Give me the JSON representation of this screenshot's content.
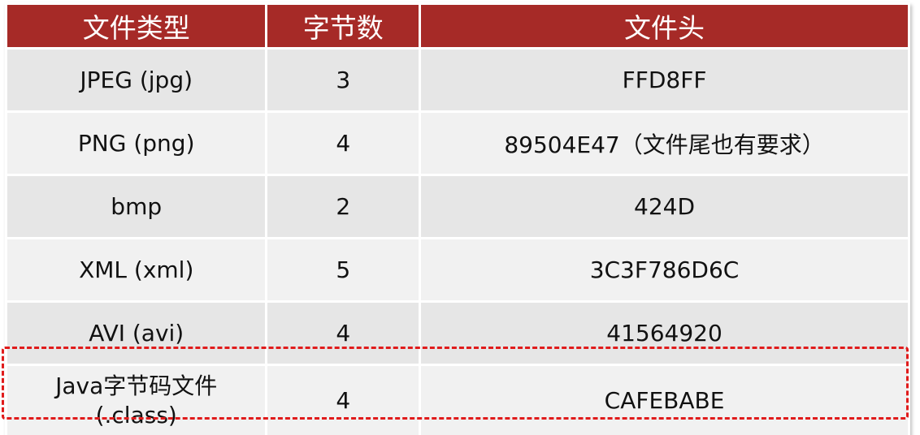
{
  "table": {
    "headers": [
      "文件类型",
      "字节数",
      "文件头"
    ],
    "rows": [
      {
        "type": "JPEG (jpg)",
        "bytes": "3",
        "header": "FFD8FF"
      },
      {
        "type": "PNG (png)",
        "bytes": "4",
        "header": "89504E47（文件尾也有要求）"
      },
      {
        "type": "bmp",
        "bytes": "2",
        "header": "424D"
      },
      {
        "type": "XML (xml)",
        "bytes": "5",
        "header": "3C3F786D6C"
      },
      {
        "type": "AVI (avi)",
        "bytes": "4",
        "header": "41564920"
      },
      {
        "type_line1": "Java字节码文件",
        "type_line2": "(.class)",
        "bytes": "4",
        "header": "CAFEBABE"
      }
    ]
  },
  "colors": {
    "header_bg": "#a62a27",
    "header_text": "#ffffff",
    "row_dark": "#e6e6e6",
    "row_light": "#f1f1f1",
    "highlight_border": "#e01b1b"
  }
}
